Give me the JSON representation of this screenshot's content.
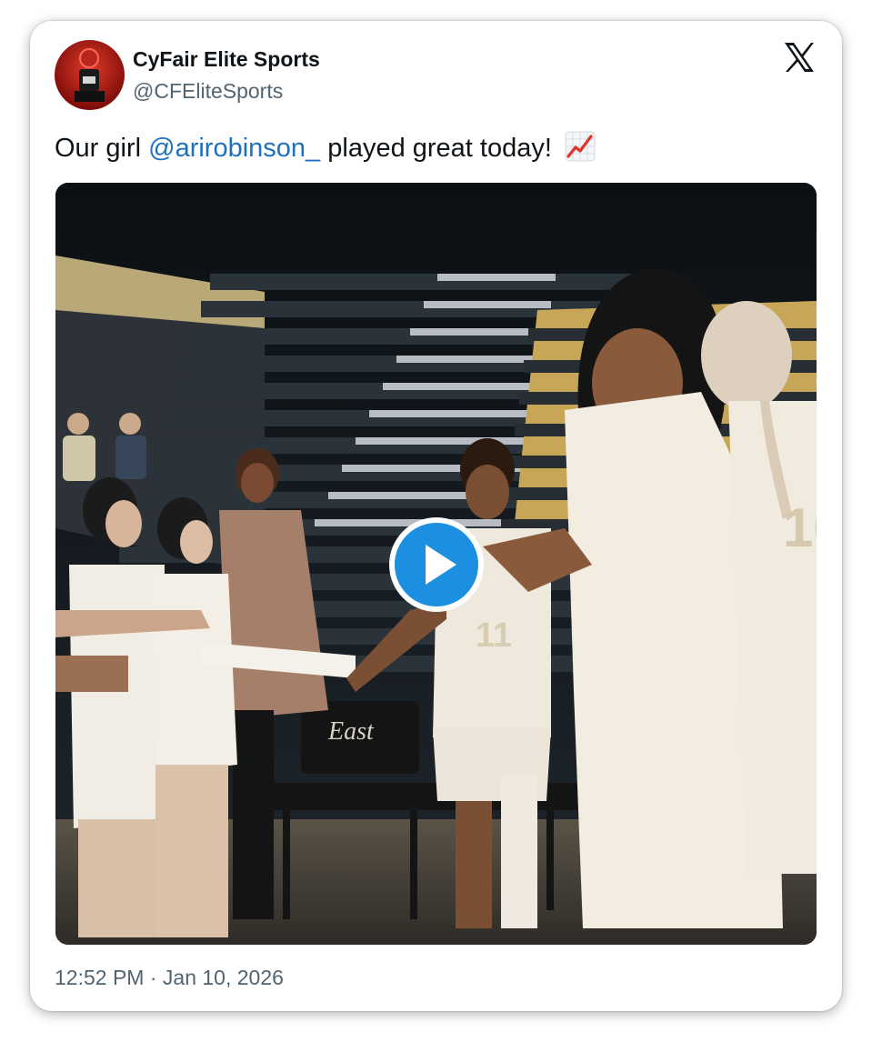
{
  "author": {
    "name": "CyFair Elite Sports",
    "handle": "@CFEliteSports"
  },
  "tweet": {
    "text_before": "Our girl ",
    "mention": "@arirobinson_",
    "text_after": " played great today!",
    "emoji": "chart-increasing-emoji"
  },
  "media": {
    "type": "video",
    "play_icon": "play-icon",
    "chair_text": "East"
  },
  "footer": {
    "time": "12:52 PM",
    "separator": "·",
    "date": "Jan 10, 2026"
  },
  "colors": {
    "name": "#0f1419",
    "secondary": "#536471",
    "mention": "#1d6fc0",
    "play_button": "#1d8fe1"
  }
}
